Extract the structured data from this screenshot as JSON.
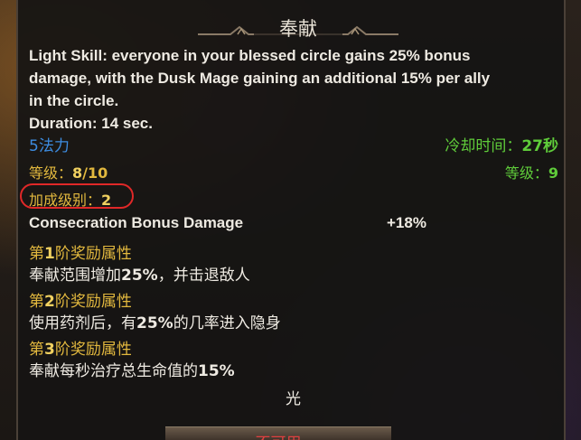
{
  "tooltip": {
    "title": "奉献",
    "description_lines": [
      "Light Skill: everyone in your blessed circle gains 25% bonus",
      "damage, with the Dusk Mage gaining an additional 15% per ally",
      "in the circle.",
      "Duration: 14 sec."
    ],
    "cost": "5法力",
    "cooldown_label": "冷却时间：",
    "cooldown_value": "27秒",
    "level_label": "等级：",
    "level_current": "8",
    "level_max": "/10",
    "req_level_label": "等级：",
    "req_level_value": "9",
    "bonus_level_label": "加成级别：",
    "bonus_level_value": "2",
    "bonus_stat_name": "Consecration Bonus Damage",
    "bonus_stat_value": "+18%",
    "tiers": [
      {
        "prefix": "第",
        "num": "1",
        "suffix": "阶奖励属性",
        "desc_a": "奉献范围增加",
        "desc_pct": "25%",
        "desc_b": "，并击退敌人"
      },
      {
        "prefix": "第",
        "num": "2",
        "suffix": "阶奖励属性",
        "desc_a": "使用药剂后，有",
        "desc_pct": "25%",
        "desc_b": "的几率进入隐身"
      },
      {
        "prefix": "第",
        "num": "3",
        "suffix": "阶奖励属性",
        "desc_a": "奉献每秒治疗总生命值的",
        "desc_pct": "15%",
        "desc_b": ""
      }
    ],
    "element": "光",
    "footer_button": "不可用"
  },
  "colors": {
    "cost_blue": "#3d8ce0",
    "cooldown_green": "#5fcc3a",
    "tier_gold": "#e2b83e",
    "highlight_red": "#e02828"
  }
}
